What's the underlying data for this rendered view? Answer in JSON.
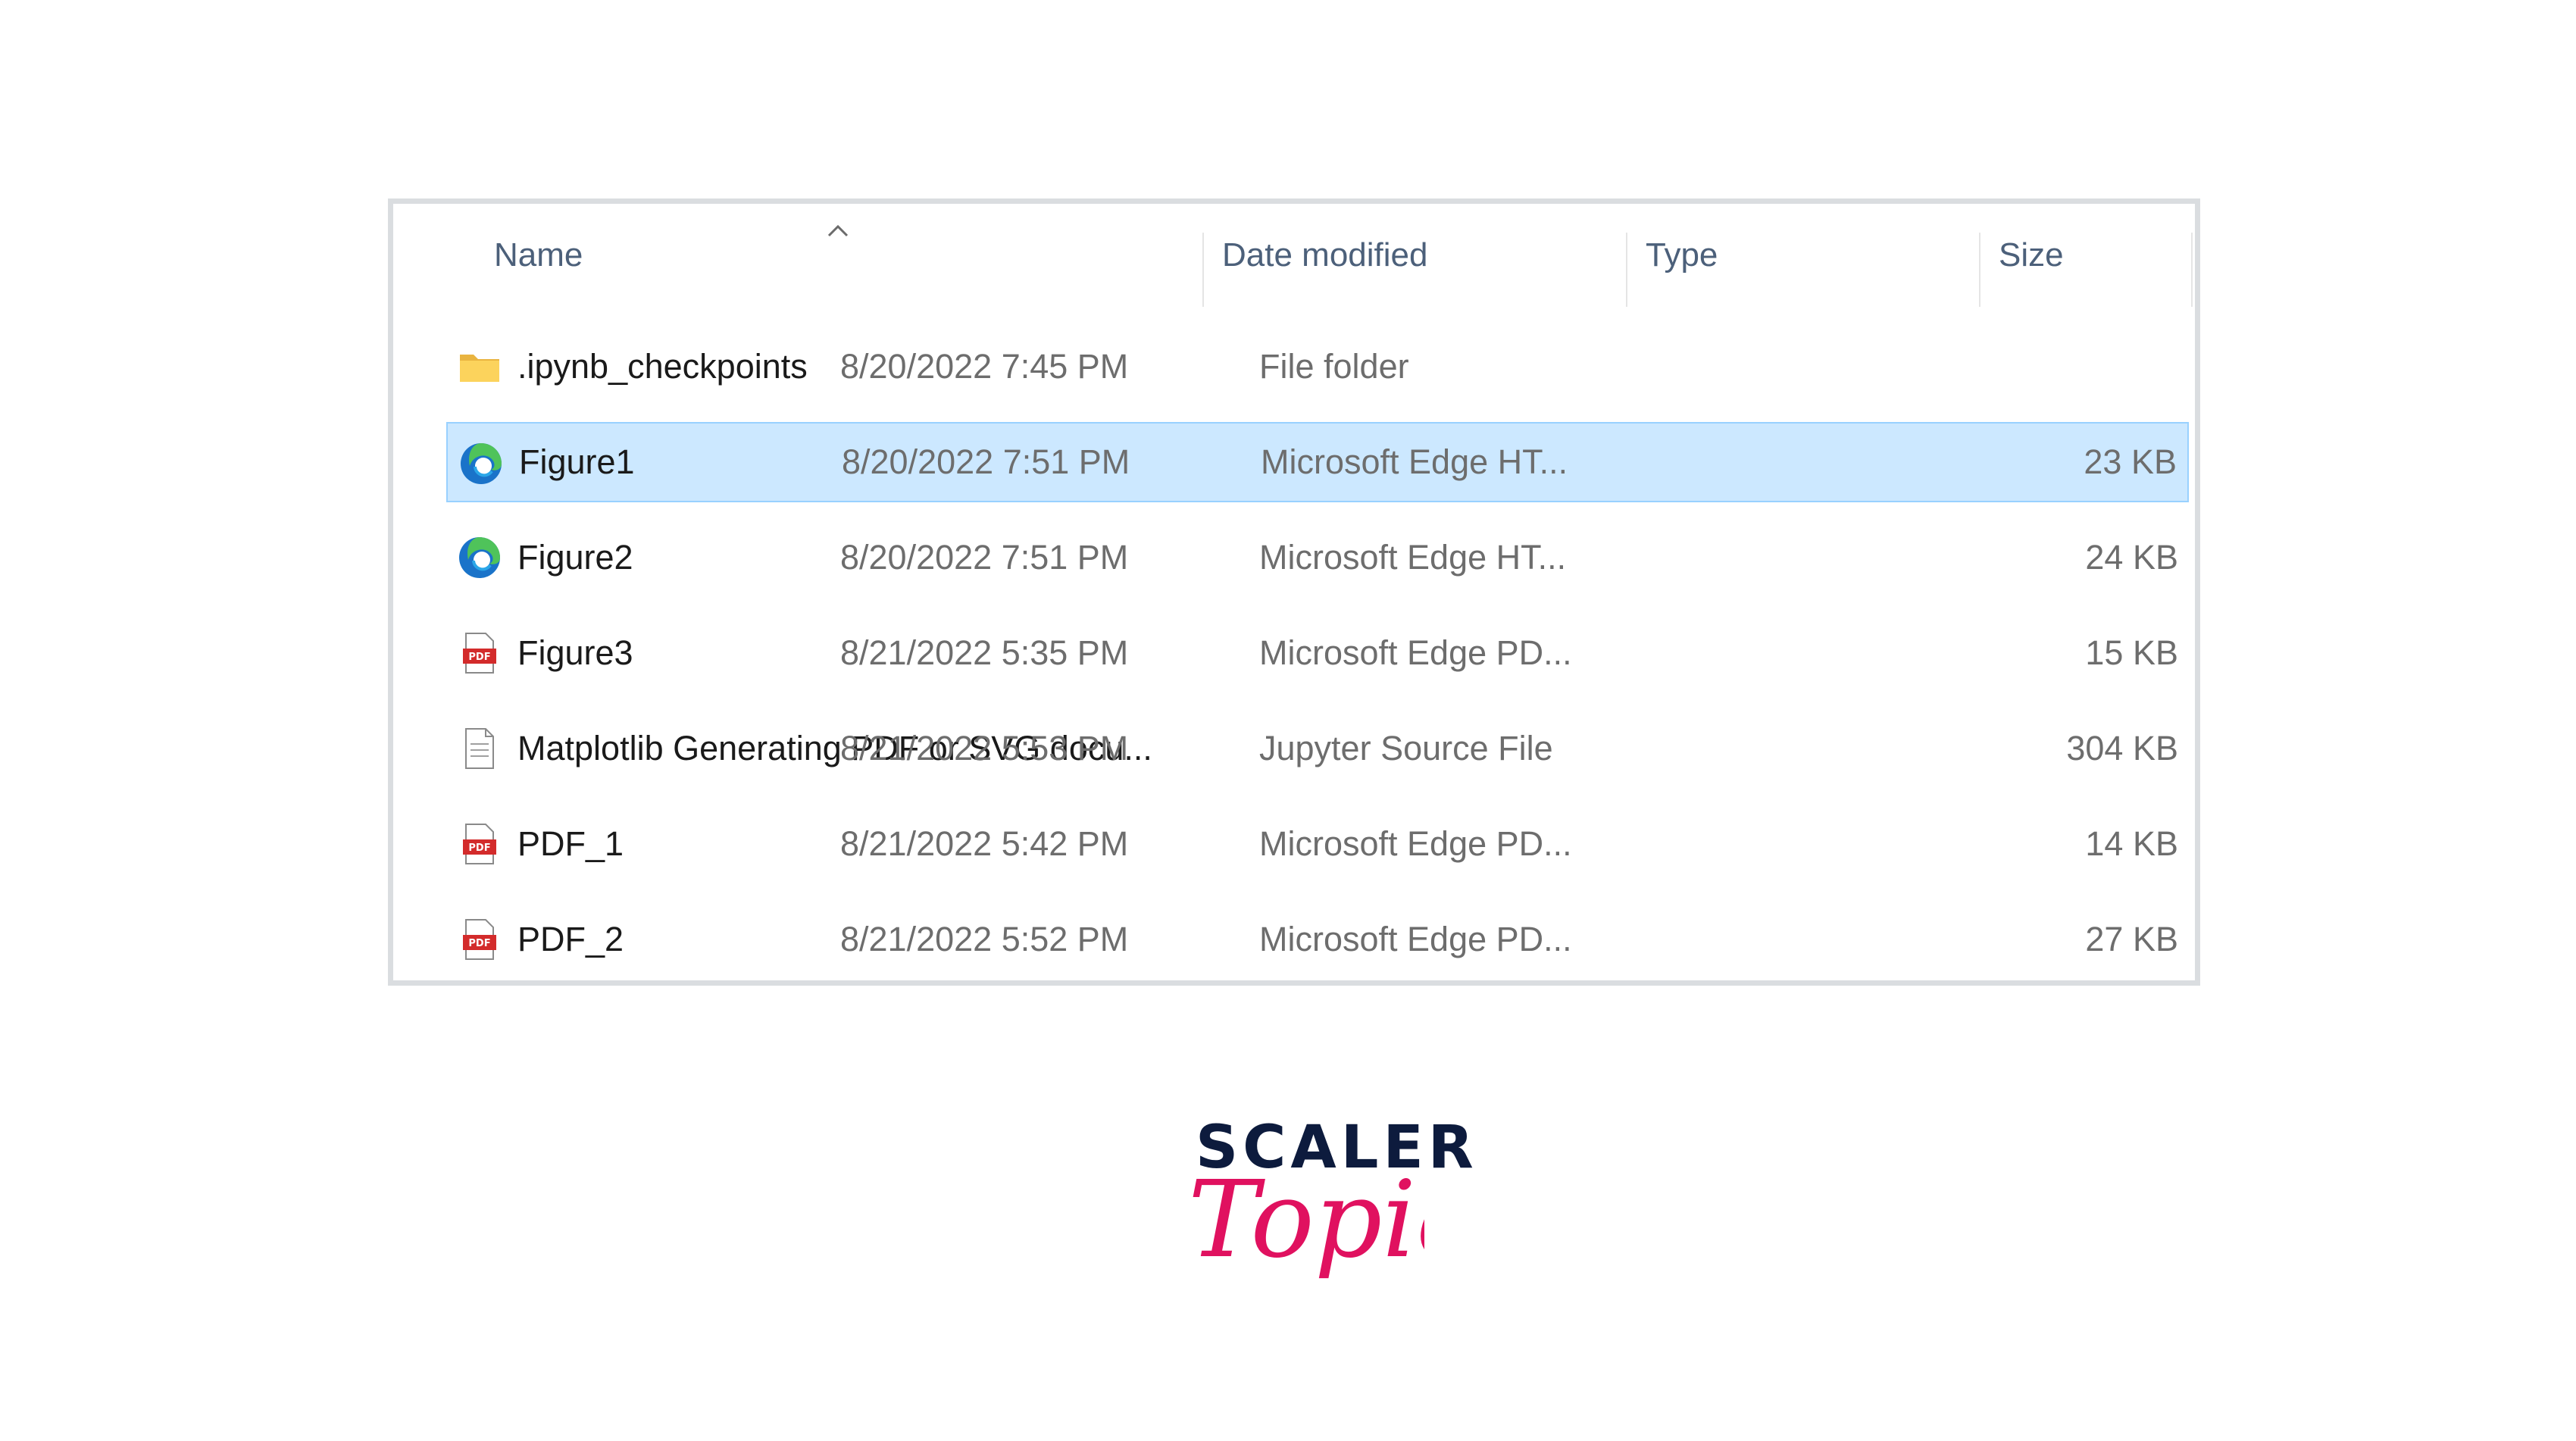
{
  "columns": {
    "name": "Name",
    "date": "Date modified",
    "type": "Type",
    "size": "Size"
  },
  "sort": {
    "column": "name",
    "direction": "ascending"
  },
  "files": [
    {
      "icon": "folder-icon",
      "name": ".ipynb_checkpoints",
      "date": "8/20/2022 7:45 PM",
      "type": "File folder",
      "size": "",
      "selected": false
    },
    {
      "icon": "edge-icon",
      "name": "Figure1",
      "date": "8/20/2022 7:51 PM",
      "type": "Microsoft Edge HT...",
      "size": "23 KB",
      "selected": true
    },
    {
      "icon": "edge-icon",
      "name": "Figure2",
      "date": "8/20/2022 7:51 PM",
      "type": "Microsoft Edge HT...",
      "size": "24 KB",
      "selected": false
    },
    {
      "icon": "pdf-icon",
      "name": "Figure3",
      "date": "8/21/2022 5:35 PM",
      "type": "Microsoft Edge PD...",
      "size": "15 KB",
      "selected": false
    },
    {
      "icon": "document-icon",
      "name": "Matplotlib Generating PDF or SVG docu...",
      "date": "8/21/2022 5:53 PM",
      "type": "Jupyter Source File",
      "size": "304 KB",
      "selected": false
    },
    {
      "icon": "pdf-icon",
      "name": "PDF_1",
      "date": "8/21/2022 5:42 PM",
      "type": "Microsoft Edge PD...",
      "size": "14 KB",
      "selected": false
    },
    {
      "icon": "pdf-icon",
      "name": "PDF_2",
      "date": "8/21/2022 5:52 PM",
      "type": "Microsoft Edge PD...",
      "size": "27 KB",
      "selected": false
    }
  ],
  "logo": {
    "wordmark": "SCALER",
    "script": "Topics",
    "colors": {
      "wordmark": "#0d1b3d",
      "script": "#e0115f"
    }
  },
  "colors": {
    "selection_fill": "#cce8ff",
    "selection_border": "#99d1ff",
    "header_text": "#4c607a",
    "secondary_text": "#6d6d6d",
    "frame_border": "#dadde0"
  }
}
